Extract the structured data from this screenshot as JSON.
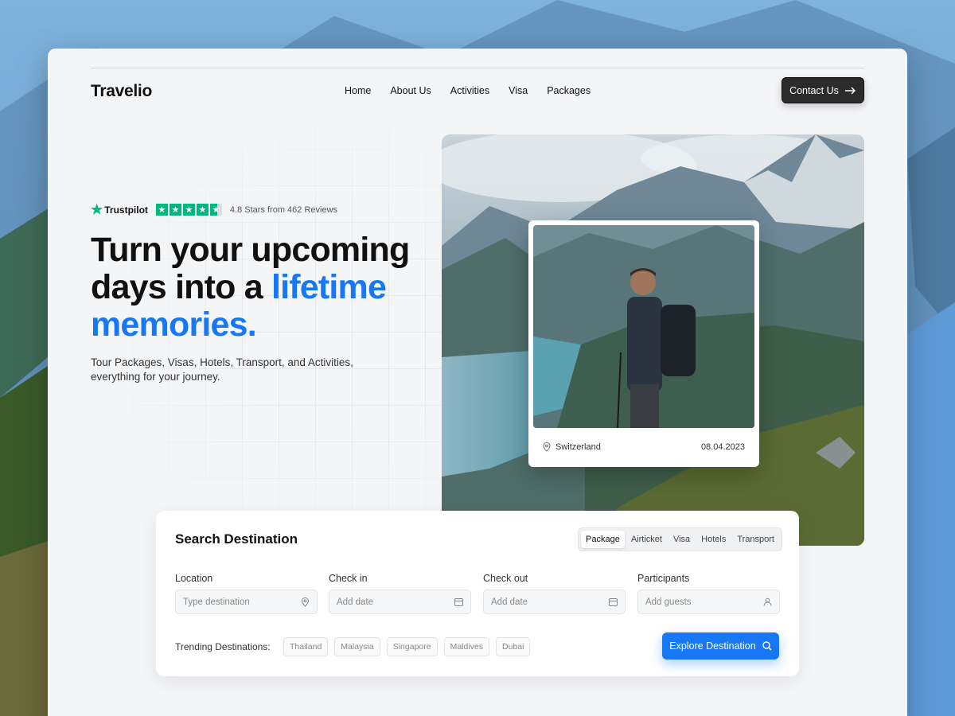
{
  "brand": {
    "name": "Travelio"
  },
  "nav": {
    "items": [
      "Home",
      "About Us",
      "Activities",
      "Visa",
      "Packages"
    ],
    "contact_label": "Contact Us"
  },
  "trust": {
    "provider": "Trustpilot",
    "rating_text": "4.8 Stars from 462 Reviews",
    "stars": 4.8
  },
  "hero": {
    "headline_part1": "Turn your upcoming days into a ",
    "headline_highlight": "lifetime memories.",
    "subtext": "Tour Packages, Visas, Hotels, Transport, and Activities, everything for your journey.",
    "photo_location": "Switzerland",
    "photo_date": "08.04.2023"
  },
  "search": {
    "title": "Search Destination",
    "tabs": [
      "Package",
      "Airticket",
      "Visa",
      "Hotels",
      "Transport"
    ],
    "active_tab": "Package",
    "fields": {
      "location": {
        "label": "Location",
        "placeholder": "Type destination"
      },
      "checkin": {
        "label": "Check in",
        "placeholder": "Add date"
      },
      "checkout": {
        "label": "Check out",
        "placeholder": "Add date"
      },
      "participants": {
        "label": "Participants",
        "placeholder": "Add guests"
      }
    },
    "trending_label": "Trending Destinations:",
    "trending": [
      "Thailand",
      "Malaysia",
      "Singapore",
      "Maldives",
      "Dubai"
    ],
    "explore_label": "Explore Destination"
  },
  "colors": {
    "accent": "#1877f2",
    "trustpilot": "#00b67a",
    "dark_button": "#2b2b2b"
  }
}
